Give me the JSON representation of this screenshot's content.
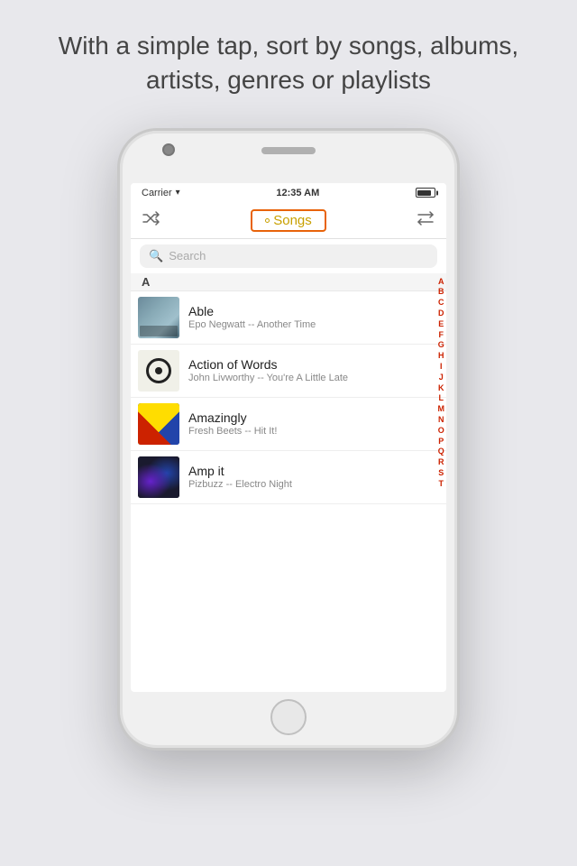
{
  "header": {
    "text": "With a simple tap, sort by songs, albums, artists, genres or playlists"
  },
  "phone": {
    "status_bar": {
      "carrier": "Carrier",
      "wifi": "WiFi",
      "time": "12:35 AM",
      "battery": "battery"
    },
    "nav": {
      "shuffle_label": "shuffle",
      "title": "Songs",
      "title_dot": "•",
      "repeat_label": "repeat"
    },
    "search": {
      "placeholder": "Search"
    },
    "songs": {
      "section_a": "A",
      "items": [
        {
          "title": "Able",
          "subtitle": "Epo Negwatt -- Another Time",
          "art_type": "able"
        },
        {
          "title": "Action of Words",
          "subtitle": "John Livworthy -- You're A Little Late",
          "art_type": "action"
        },
        {
          "title": "Amazingly",
          "subtitle": "Fresh Beets -- Hit It!",
          "art_type": "amazingly"
        },
        {
          "title": "Amp it",
          "subtitle": "Pizbuzz -- Electro Night",
          "art_type": "amp"
        }
      ]
    },
    "alphabet": [
      "A",
      "B",
      "C",
      "D",
      "E",
      "F",
      "G",
      "H",
      "I",
      "J",
      "K",
      "L",
      "M",
      "N",
      "O",
      "P",
      "Q",
      "R",
      "S",
      "T"
    ]
  },
  "colors": {
    "accent": "#e8630a",
    "title_color": "#c8a000",
    "alpha_color": "#cc2200",
    "background": "#e8e8ec"
  }
}
